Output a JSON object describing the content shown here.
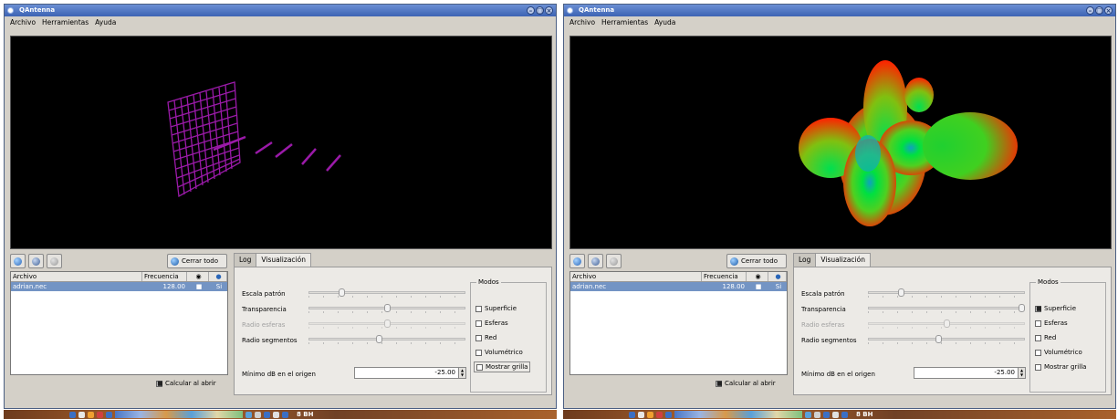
{
  "windows": [
    {
      "title": "QAntenna",
      "menu": [
        "Archivo",
        "Herramientas",
        "Ayuda"
      ],
      "toolbar": {
        "close_all_label": "Cerrar todo"
      },
      "files": {
        "headers": [
          "Archivo",
          "Frecuencia",
          "",
          ""
        ],
        "rows": [
          {
            "file": "adrian.nec",
            "freq": "128.00",
            "visible": "■",
            "selected": "Si"
          }
        ]
      },
      "calc_label": "Calcular al abrir",
      "tabs": [
        "Log",
        "Visualización"
      ],
      "sliders": [
        {
          "label": "Escala patrón",
          "value": 0.2,
          "disabled": false
        },
        {
          "label": "Transparencia",
          "value": 0.5,
          "disabled": false
        },
        {
          "label": "Radio esferas",
          "value": 0.5,
          "disabled": true
        },
        {
          "label": "Radio segmentos",
          "value": 0.45,
          "disabled": false
        }
      ],
      "min_db_label": "Mínimo dB en el origen",
      "min_db_value": "-25.00",
      "modos": {
        "title": "Modos",
        "items": [
          {
            "label": "Superficie",
            "checked": false
          },
          {
            "label": "Esferas",
            "checked": false
          },
          {
            "label": "Red",
            "checked": false
          },
          {
            "label": "Volumétrico",
            "checked": false
          },
          {
            "label": "Mostrar grilla",
            "checked": false
          }
        ]
      },
      "viewport": "antenna grid wireframe"
    },
    {
      "title": "QAntenna",
      "menu": [
        "Archivo",
        "Herramientas",
        "Ayuda"
      ],
      "toolbar": {
        "close_all_label": "Cerrar todo"
      },
      "files": {
        "headers": [
          "Archivo",
          "Frecuencia",
          "",
          ""
        ],
        "rows": [
          {
            "file": "adrian.nec",
            "freq": "128.00",
            "visible": "■",
            "selected": "Si"
          }
        ]
      },
      "calc_label": "Calcular al abrir",
      "tabs": [
        "Log",
        "Visualización"
      ],
      "sliders": [
        {
          "label": "Escala patrón",
          "value": 0.2,
          "disabled": false
        },
        {
          "label": "Transparencia",
          "value": 1.0,
          "disabled": false
        },
        {
          "label": "Radio esferas",
          "value": 0.5,
          "disabled": true
        },
        {
          "label": "Radio segmentos",
          "value": 0.45,
          "disabled": false
        }
      ],
      "min_db_label": "Mínimo dB en el origen",
      "min_db_value": "-25.00",
      "modos": {
        "title": "Modos",
        "items": [
          {
            "label": "Superficie",
            "checked": true
          },
          {
            "label": "Esferas",
            "checked": false
          },
          {
            "label": "Red",
            "checked": false
          },
          {
            "label": "Volumétrico",
            "checked": false
          },
          {
            "label": "Mostrar grilla",
            "checked": false
          }
        ]
      },
      "viewport": "radiation pattern surface"
    }
  ],
  "colors": {
    "title_bar": "#3c63b4",
    "selection": "#7394c4",
    "antenna": "#9a1aa8",
    "pattern_center": "#00e040",
    "pattern_edge": "#ff2000"
  }
}
